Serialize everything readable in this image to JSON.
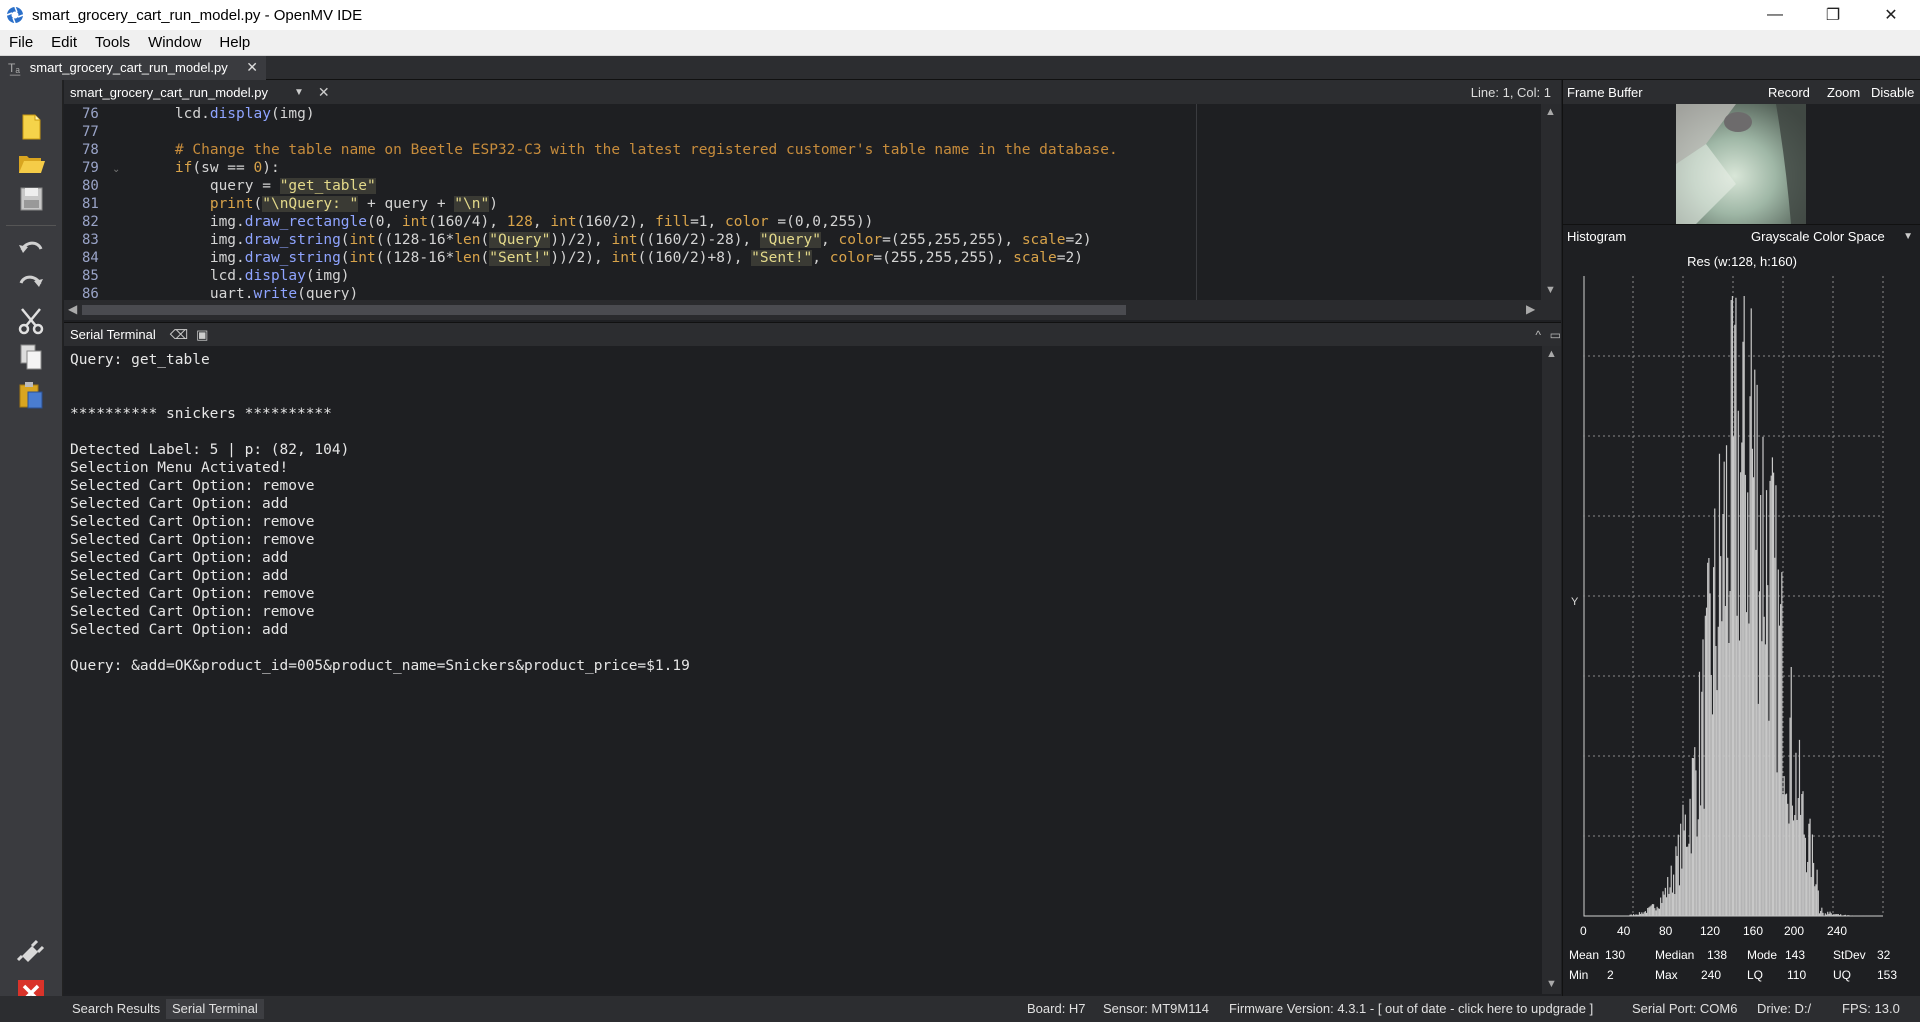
{
  "window": {
    "title": "smart_grocery_cart_run_model.py - OpenMV IDE",
    "minimize": "—",
    "restore": "❐",
    "close": "✕"
  },
  "menu": [
    "File",
    "Edit",
    "Tools",
    "Window",
    "Help"
  ],
  "doc_tab": {
    "label": "smart_grocery_cart_run_model.py",
    "close": "✕"
  },
  "editor": {
    "filename": "smart_grocery_cart_run_model.py",
    "cursor": "Line: 1, Col: 1",
    "line_numbers": [
      "76",
      "77",
      "78",
      "79",
      "80",
      "81",
      "82",
      "83",
      "84",
      "85",
      "86"
    ]
  },
  "terminal": {
    "title": "Serial Terminal",
    "lines": [
      "Query: get_table",
      "",
      "",
      "********** snickers **********",
      "",
      "Detected Label: 5 | p: (82, 104)",
      "Selection Menu Activated!",
      "Selected Cart Option: remove",
      "Selected Cart Option: add",
      "Selected Cart Option: remove",
      "Selected Cart Option: remove",
      "Selected Cart Option: add",
      "Selected Cart Option: add",
      "Selected Cart Option: remove",
      "Selected Cart Option: remove",
      "Selected Cart Option: add",
      "",
      "Query: &add=OK&product_id=005&product_name=Snickers&product_price=$1.19"
    ]
  },
  "frame_buffer": {
    "label": "Frame Buffer",
    "record": "Record",
    "zoom": "Zoom",
    "disable": "Disable"
  },
  "histogram": {
    "label": "Histogram",
    "mode": "Grayscale Color Space",
    "resolution": "Res (w:128, h:160)",
    "y_label": "Y",
    "x_ticks": [
      "0",
      "40",
      "80",
      "120",
      "160",
      "200",
      "240"
    ],
    "stats": {
      "mean_label": "Mean",
      "mean": "130",
      "median_label": "Median",
      "median": "138",
      "mode_label": "Mode",
      "mode": "143",
      "stdev_label": "StDev",
      "stdev": "32",
      "min_label": "Min",
      "min": "2",
      "max_label": "Max",
      "max": "240",
      "lq_label": "LQ",
      "lq": "110",
      "uq_label": "UQ",
      "uq": "153"
    }
  },
  "status": {
    "search_results": "Search Results",
    "serial_terminal": "Serial Terminal",
    "board": "Board: H7",
    "sensor": "Sensor: MT9M114",
    "firmware": "Firmware Version: 4.3.1 - [ out of date - click here to updgrade ]",
    "serial_port": "Serial Port: COM6",
    "drive": "Drive: D:/",
    "fps": "FPS:  13.0"
  },
  "colors": {
    "background": "#1e1f22",
    "panel": "#2c2d30",
    "keyword": "#d8a34a",
    "function": "#8fa4ff",
    "string": "#e3d98a",
    "comment": "#c78c3c"
  }
}
